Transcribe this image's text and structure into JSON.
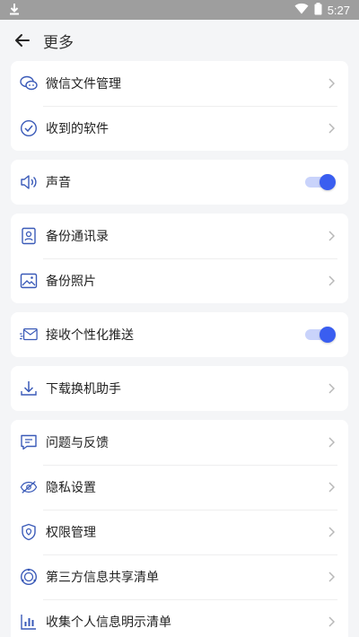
{
  "status_bar": {
    "time": "5:27",
    "download_icon": "download-arrow-icon",
    "wifi_icon": "wifi-icon",
    "battery_icon": "battery-icon"
  },
  "header": {
    "title": "更多",
    "back_icon": "back-arrow-icon"
  },
  "colors": {
    "accent": "#3a5ef0",
    "toggle_track": "#c9d3fb",
    "icon_stroke": "#3a5ab8",
    "background": "#f4f5f7"
  },
  "groups": [
    {
      "items": [
        {
          "label": "微信文件管理",
          "icon": "wechat-icon",
          "control": "chevron"
        },
        {
          "label": "收到的软件",
          "icon": "check-circle-icon",
          "control": "chevron"
        }
      ]
    },
    {
      "items": [
        {
          "label": "声音",
          "icon": "speaker-icon",
          "control": "toggle",
          "on": true
        }
      ]
    },
    {
      "items": [
        {
          "label": "备份通讯录",
          "icon": "contact-book-icon",
          "control": "chevron"
        },
        {
          "label": "备份照片",
          "icon": "photo-icon",
          "control": "chevron"
        }
      ]
    },
    {
      "items": [
        {
          "label": "接收个性化推送",
          "icon": "mail-icon",
          "control": "toggle",
          "on": true
        }
      ]
    },
    {
      "items": [
        {
          "label": "下载换机助手",
          "icon": "download-icon",
          "control": "chevron"
        }
      ]
    },
    {
      "items": [
        {
          "label": "问题与反馈",
          "icon": "feedback-icon",
          "control": "chevron"
        },
        {
          "label": "隐私设置",
          "icon": "eye-off-icon",
          "control": "chevron"
        },
        {
          "label": "权限管理",
          "icon": "shield-location-icon",
          "control": "chevron"
        },
        {
          "label": "第三方信息共享清单",
          "icon": "share-circle-icon",
          "control": "chevron"
        },
        {
          "label": "收集个人信息明示清单",
          "icon": "bar-chart-icon",
          "control": "chevron"
        }
      ]
    }
  ]
}
